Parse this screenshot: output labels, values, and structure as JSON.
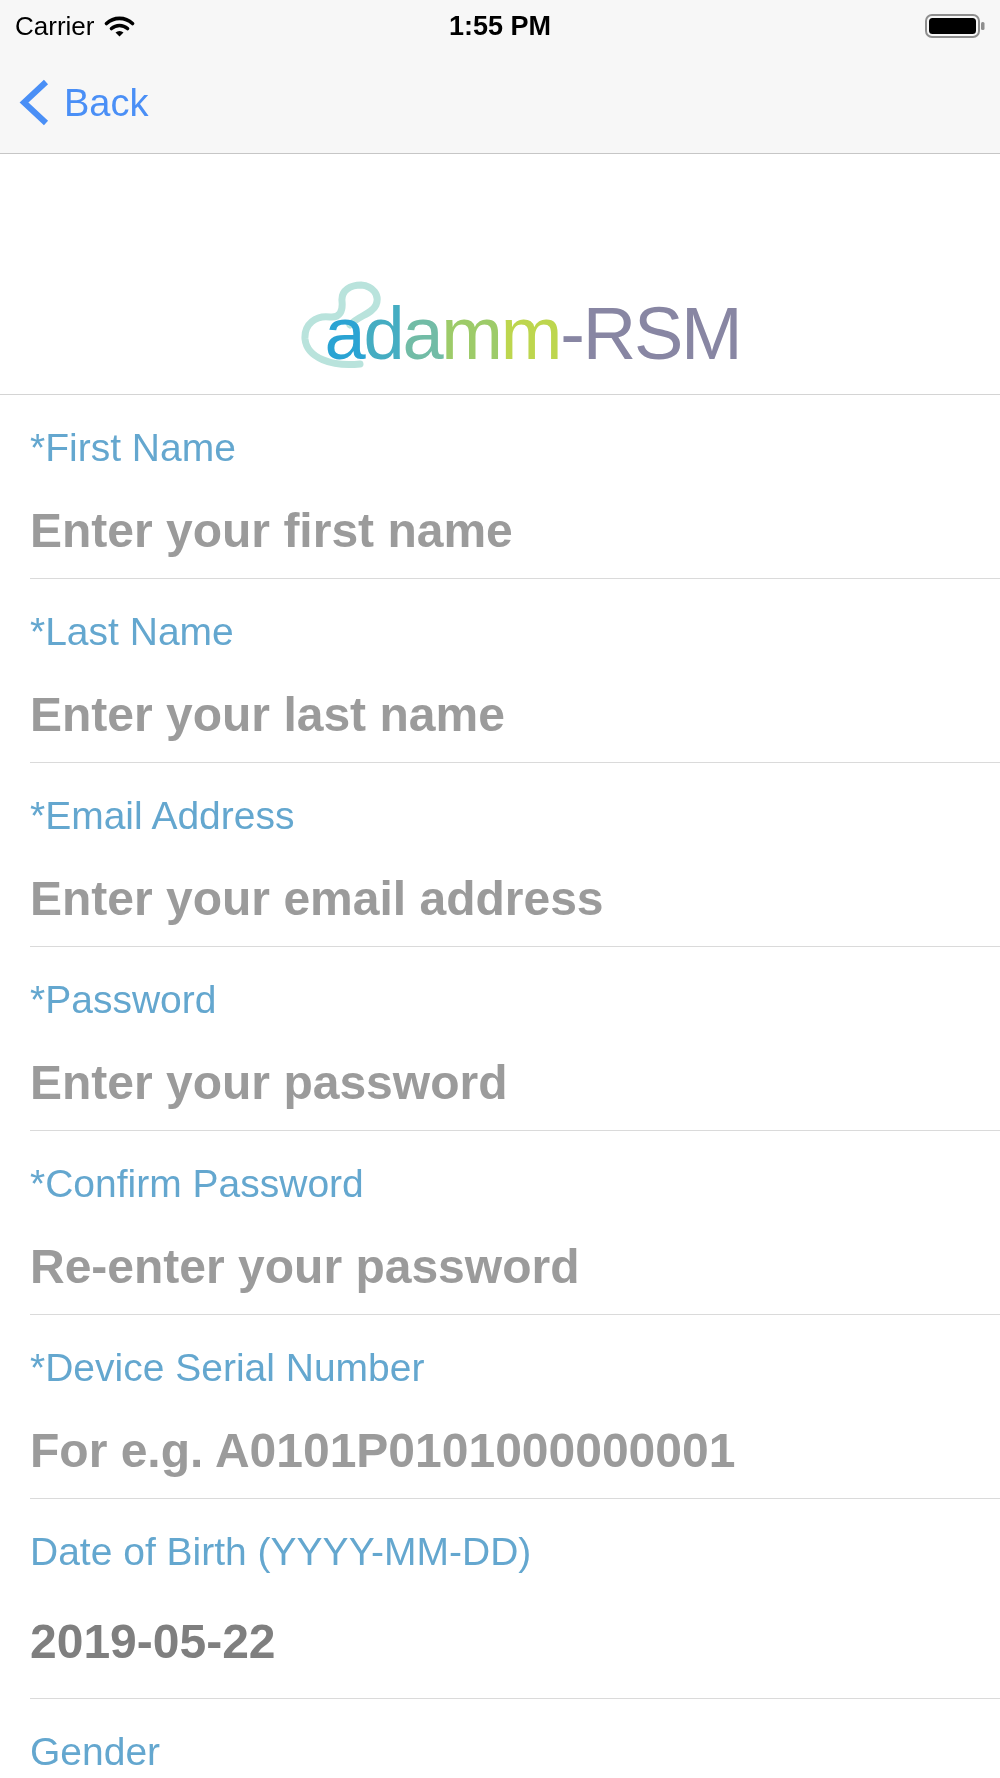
{
  "status_bar": {
    "carrier": "Carrier",
    "time": "1:55 PM"
  },
  "nav_bar": {
    "back": "Back"
  },
  "logo": {
    "parts": [
      {
        "text": "a",
        "color": "#2aa3d3"
      },
      {
        "text": "d",
        "color": "#45adc2"
      },
      {
        "text": "a",
        "color": "#72bca6"
      },
      {
        "text": "m",
        "color": "#9dcb69"
      },
      {
        "text": "m",
        "color": "#bdd64e"
      },
      {
        "text": "-RSM",
        "color": "#8886a3"
      }
    ]
  },
  "fields": [
    {
      "label": "*First Name",
      "placeholder": "Enter your first name"
    },
    {
      "label": "*Last Name",
      "placeholder": "Enter your last name"
    },
    {
      "label": "*Email Address",
      "placeholder": "Enter your email address"
    },
    {
      "label": "*Password",
      "placeholder": "Enter your password"
    },
    {
      "label": "*Confirm Password",
      "placeholder": "Re-enter your password"
    },
    {
      "label": "*Device Serial Number",
      "placeholder": "For e.g. A0101P0101000000001"
    },
    {
      "label": "Date of Birth (YYYY-MM-DD)",
      "value": "2019-05-22"
    },
    {
      "label": "Gender"
    }
  ]
}
